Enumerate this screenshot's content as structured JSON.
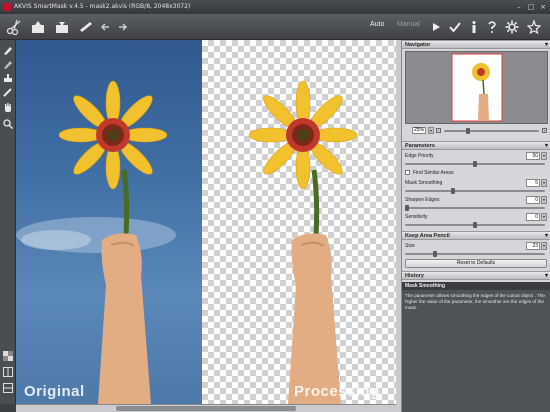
{
  "window": {
    "title": "AKVIS SmartMask v.4.5 - mask2.akvis (RGB/8, 2048x3072)",
    "controls": [
      "minimize",
      "maximize",
      "close"
    ]
  },
  "toolbar": {
    "mode_auto": "Auto",
    "mode_manual": "Manual",
    "left_tools": [
      "new-icon",
      "open-icon",
      "save-icon",
      "brush-settings-icon",
      "back-icon",
      "forward-icon"
    ],
    "right_tools": [
      "play-icon",
      "apply-icon",
      "info-icon",
      "help-icon",
      "settings-icon",
      "akvis-icon"
    ]
  },
  "canvas": {
    "original_label": "Original",
    "processing_label": "Processing"
  },
  "navigator": {
    "title": "Navigator",
    "zoom": "25%"
  },
  "parameters": {
    "title": "Parameters",
    "edge_priority": {
      "label": "Edge Priority",
      "value": "50"
    },
    "find_similar": {
      "label": "Find Similar Areas",
      "checked": false
    },
    "mask_smoothing": {
      "label": "Mask Smoothing",
      "value": "5"
    },
    "sharpen_edges": {
      "label": "Sharpen Edges",
      "value": "0"
    },
    "sensitivity": {
      "label": "Sensitivity",
      "value": "0"
    }
  },
  "keep_pencil": {
    "title": "Keep Area Pencil",
    "size": {
      "label": "Size",
      "value": "23"
    },
    "reset_label": "Reset to Defaults"
  },
  "history": {
    "title": "History",
    "heading": "Mask Smoothing",
    "text": "The parameter allows smoothing the edges of the cutout object . The higher the value of the parameter, the smoother are the edges of the mask."
  }
}
